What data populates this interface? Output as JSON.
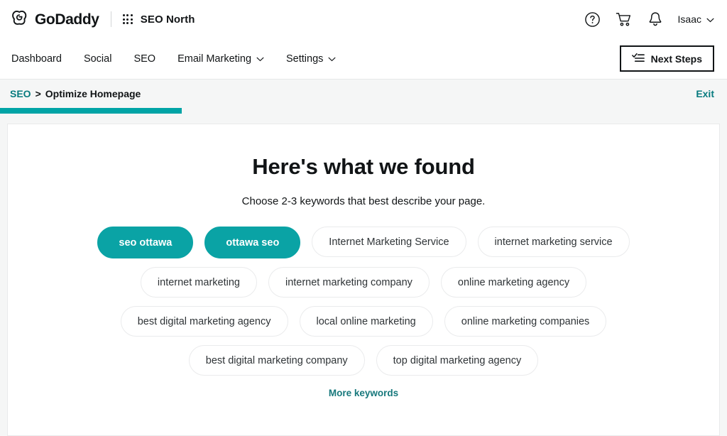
{
  "header": {
    "logo_icon": "godaddy-heart-logo-icon",
    "wordmark": "GoDaddy",
    "apps_icon": "apps-grid-icon",
    "site_name": "SEO North",
    "help_icon": "help-circle-icon",
    "cart_icon": "shopping-cart-icon",
    "notifications_icon": "bell-icon",
    "account_name": "Isaac",
    "account_chevron_icon": "chevron-down-icon"
  },
  "nav": {
    "items": [
      {
        "label": "Dashboard",
        "has_caret": false
      },
      {
        "label": "Social",
        "has_caret": false
      },
      {
        "label": "SEO",
        "has_caret": false
      },
      {
        "label": "Email Marketing",
        "has_caret": true
      },
      {
        "label": "Settings",
        "has_caret": true
      }
    ],
    "next_steps_label": "Next Steps",
    "next_steps_icon": "checklist-icon"
  },
  "breadcrumb": {
    "parent": "SEO",
    "separator": ">",
    "current": "Optimize Homepage",
    "exit_label": "Exit"
  },
  "progress": {
    "percent": 25,
    "fill_color": "#00a4a6",
    "track_color": "#f5f6f6"
  },
  "main": {
    "title": "Here's what we found",
    "subtitle": "Choose 2-3 keywords that best describe your page.",
    "more_keywords_label": "More keywords",
    "accent_color": "#0aa3a5",
    "link_color": "#087b7f",
    "keyword_rows": [
      [
        {
          "label": "seo ottawa",
          "selected": true
        },
        {
          "label": "ottawa seo",
          "selected": true
        },
        {
          "label": "Internet Marketing Service",
          "selected": false
        },
        {
          "label": "internet marketing service",
          "selected": false
        }
      ],
      [
        {
          "label": "internet marketing",
          "selected": false
        },
        {
          "label": "internet marketing company",
          "selected": false
        },
        {
          "label": "online marketing agency",
          "selected": false
        }
      ],
      [
        {
          "label": "best digital marketing agency",
          "selected": false
        },
        {
          "label": "local online marketing",
          "selected": false
        },
        {
          "label": "online marketing companies",
          "selected": false
        }
      ],
      [
        {
          "label": "best digital marketing company",
          "selected": false
        },
        {
          "label": "top digital marketing agency",
          "selected": false
        }
      ]
    ]
  }
}
